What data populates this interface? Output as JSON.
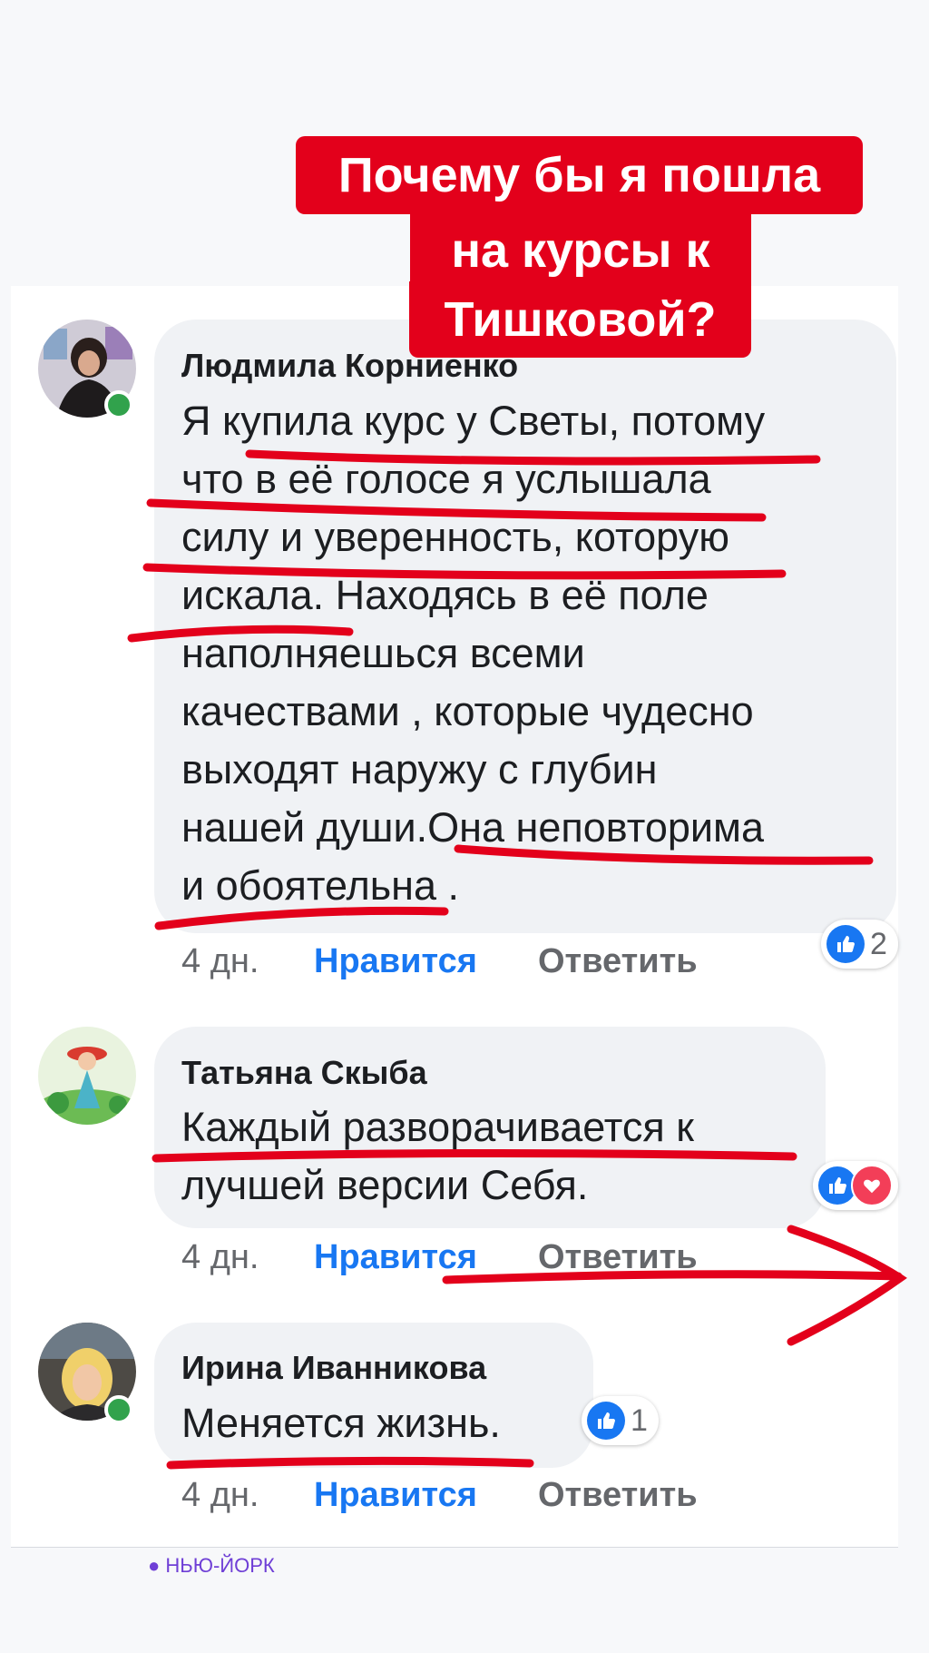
{
  "overlay": {
    "title_line1": "Почему бы я пошла",
    "title_line2": "на курсы к",
    "title_line3": "Тишковой?"
  },
  "comments": [
    {
      "author": "Людмила Корниенко",
      "text": "Я купила курс у Светы, потому\nчто в её голосе я услышала\nсилу и уверенность, которую\nискала. Находясь в её поле\nнаполняешься всеми\nкачествами , которые чудесно\nвыходят наружу с глубин\nнашей души.Она неповторима\nи обоятельна .",
      "time": "4 дн.",
      "like_label": "Нравится",
      "reply_label": "Ответить",
      "reaction_count": "2",
      "online": true
    },
    {
      "author": "Татьяна Скыба",
      "text": "Каждый разворачивается к\nлучшей версии Себя.",
      "time": "4 дн.",
      "like_label": "Нравится",
      "reply_label": "Ответить",
      "online": false
    },
    {
      "author": "Ирина Иванникова",
      "text": "Меняется жизнь.",
      "time": "4 дн.",
      "like_label": "Нравится",
      "reply_label": "Ответить",
      "reaction_count": "1",
      "online": true
    }
  ],
  "location": "НЬЮ-ЙОРК",
  "colors": {
    "accent_red": "#e3001b",
    "like_blue": "#1877f2",
    "love_red": "#f33e58",
    "online_green": "#31a24c"
  }
}
